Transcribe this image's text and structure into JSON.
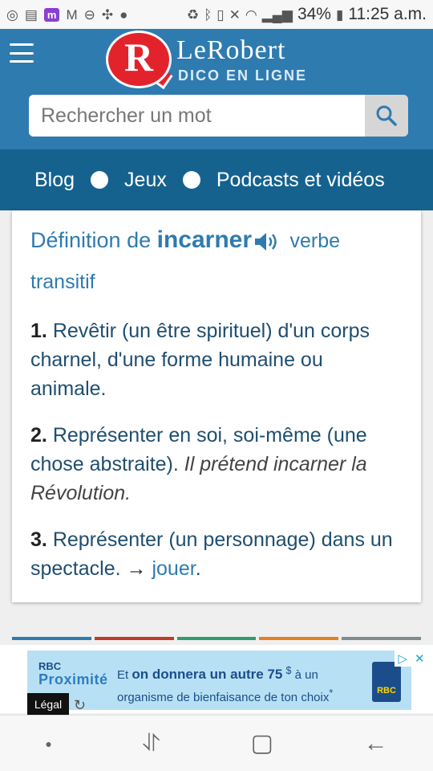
{
  "status_bar": {
    "battery": "34%",
    "time": "11:25 a.m.",
    "left_icons": [
      "chrome-icon",
      "sim-icon",
      "app-m-icon",
      "gmail-icon",
      "minus-circle-icon",
      "pinwheel-icon",
      "soccer-icon"
    ],
    "right_icons": [
      "recycle-icon",
      "bluetooth-icon",
      "vibrate-icon",
      "mute-icon",
      "wifi-icon",
      "signal-icon",
      "battery-icon"
    ]
  },
  "header": {
    "logo_letter": "R",
    "logo_name": "LeRobert",
    "logo_sub": "DICO EN LIGNE",
    "search_placeholder": "Rechercher un mot"
  },
  "nav": {
    "items": [
      "Blog",
      "Jeux",
      "Podcasts et vidéos"
    ]
  },
  "definition": {
    "prefix": "Définition de",
    "word": "incarner",
    "pos": "verbe transitif",
    "senses": [
      {
        "num": "1.",
        "text": "Revêtir (un être spirituel) d'un corps charnel, d'une forme humaine ou animale."
      },
      {
        "num": "2.",
        "text": "Représenter en soi, soi-même (une chose abstraite).",
        "example": "Il prétend incarner la Révolution."
      },
      {
        "num": "3.",
        "text": "Représenter (un personnage) dans un spectacle.",
        "arrow": "→",
        "link": "jouer",
        "after": "."
      }
    ]
  },
  "colors": {
    "header": "#2e7bb0",
    "nav": "#15628f",
    "logo_red": "#e3232b",
    "stripes": [
      "#2e7bb0",
      "#c0392b",
      "#2e9e6a",
      "#e67e22",
      "#7f8c8d"
    ]
  },
  "ad": {
    "brand_line1": "RBC",
    "brand_line2": "Proximité",
    "text_pre": "Et ",
    "text_bold": "on donnera un autre 75",
    "text_sup": "$",
    "text_post": " à un organisme de bienfaisance de ton choix",
    "text_mark": "*",
    "logo": "RBC",
    "legal": "Légal"
  },
  "android_nav": [
    "dot",
    "recent",
    "home",
    "back"
  ]
}
